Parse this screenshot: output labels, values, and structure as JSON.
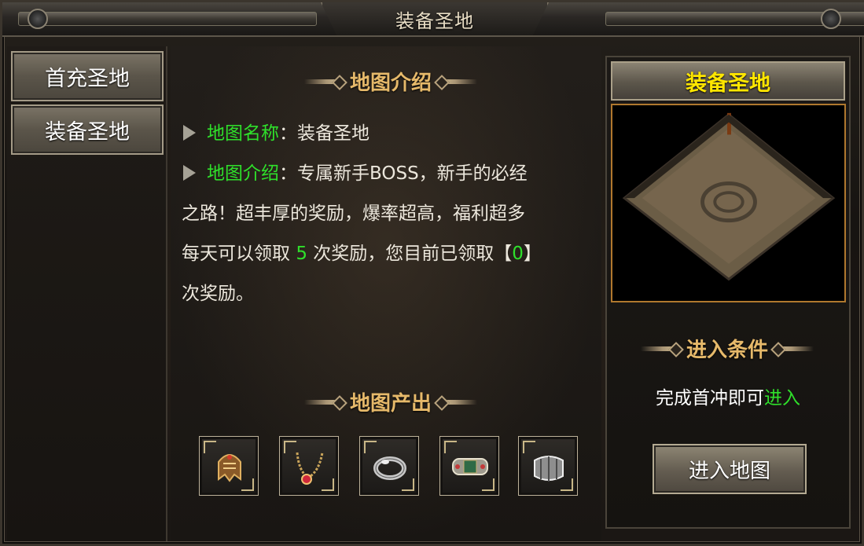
{
  "window": {
    "title": "装备圣地"
  },
  "sidebar": {
    "items": [
      {
        "label": "首充圣地"
      },
      {
        "label": "装备圣地"
      }
    ]
  },
  "intro": {
    "heading": "地图介绍",
    "name_label": "地图名称",
    "name_sep": "：",
    "name_value": "装备圣地",
    "desc_label": "地图介绍",
    "desc_sep": "：",
    "desc_line1": "专属新手BOSS，新手的必经",
    "desc_line2": "之路！超丰厚的奖励，爆率超高，福利超多",
    "claim_prefix": "每天可以领取 ",
    "claim_count": "5",
    "claim_mid": " 次奖励，您目前已领取【",
    "claimed": "0",
    "claim_suffix": "】",
    "claim_line2": "次奖励。"
  },
  "output": {
    "heading": "地图产出",
    "items": [
      {
        "icon": "helmet-icon"
      },
      {
        "icon": "necklace-icon"
      },
      {
        "icon": "ring-icon"
      },
      {
        "icon": "bracelet-icon"
      },
      {
        "icon": "armguard-icon"
      }
    ]
  },
  "right": {
    "map_title": "装备圣地",
    "condition_heading": "进入条件",
    "condition_text": "完成首冲即可",
    "condition_link": "进入",
    "enter_button": "进入地图"
  },
  "colors": {
    "highlight_green": "#2fe02b",
    "heading_gold": "#e6b96a",
    "map_title_yellow": "#ffe600"
  }
}
